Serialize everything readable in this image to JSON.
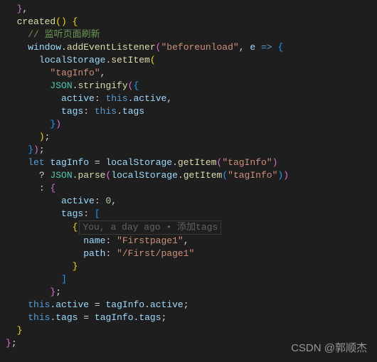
{
  "code": {
    "method": "created",
    "comment": "// 监听页面刷新",
    "windowObj": "window",
    "addEventListener": "addEventListener",
    "eventName": "\"beforeunload\"",
    "param": "e",
    "arrow": "=>",
    "localStorage": "localStorage",
    "setItem": "setItem",
    "tagInfoStr": "\"tagInfo\"",
    "JSON": "JSON",
    "stringify": "stringify",
    "activeKey": "active",
    "tagsKey": "tags",
    "thisKw": "this",
    "activeProp": "active",
    "tagsProp": "tags",
    "letKw": "let",
    "tagInfoVar": "tagInfo",
    "getItem": "getItem",
    "parse": "parse",
    "zero": "0",
    "nameKey": "name",
    "pathKey": "path",
    "firstpage": "\"Firstpage1\"",
    "firstPath": "\"/First/page1\""
  },
  "codelens": {
    "text": "You, a day ago • 添加tags"
  },
  "watermark": "CSDN @郭顺杰",
  "chart_data": null
}
